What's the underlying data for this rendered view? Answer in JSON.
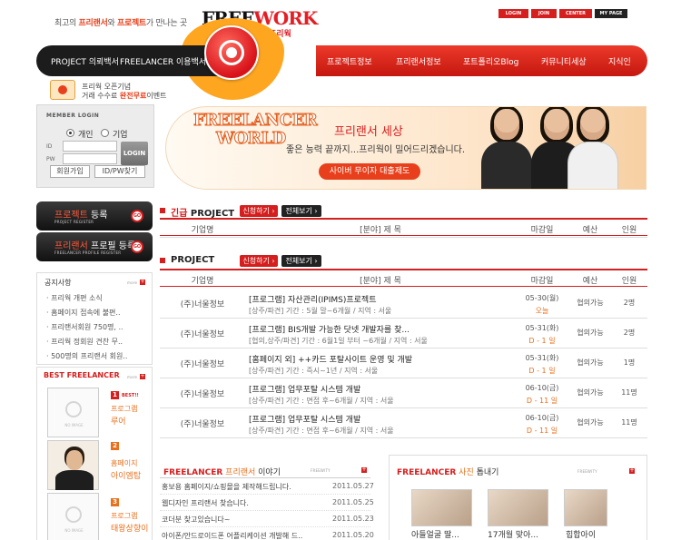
{
  "header": {
    "tagline_a": "최고의 ",
    "tagline_b": "프리랜서",
    "tagline_c": "와 ",
    "tagline_d": "프로젝트",
    "tagline_e": "가 만나는 곳",
    "logo_a": "FREE",
    "logo_b": "WORK",
    "logo_sub": "프리웍",
    "top_links": [
      "LOGIN",
      "JOIN",
      "CENTER",
      "MY PAGE"
    ]
  },
  "nav": {
    "left_items": [
      "PROJECT 의뢰백서",
      "FREELANCER 이용백서"
    ],
    "right_items": [
      "프로젝트정보",
      "프리랜서정보",
      "포트폴리오Blog",
      "커뮤니티세상",
      "지식인"
    ]
  },
  "event": {
    "line1": "프리웍 오픈기념",
    "line2_a": "거래 수수료 ",
    "line2_b": "완전무료",
    "line2_c": "이벤트"
  },
  "login": {
    "title": "MEMBER LOGIN",
    "type_personal": "개인",
    "type_company": "기업",
    "selected": "개인",
    "id_label": "ID",
    "pw_label": "PW",
    "id_value": "",
    "pw_value": "",
    "login_button": "LOGIN",
    "join_button": "회원가입",
    "find_button": "ID/PW찾기"
  },
  "banner": {
    "title1": "FREELANCER",
    "title2": "WORLD",
    "heading": "프리랜서 세상",
    "subtitle": "좋은 능력 끝까지...프리웍이 밀어드리겠습니다.",
    "button": "사이버 무이자 대출제도"
  },
  "side_buttons": [
    {
      "hl": "프로젝트",
      "label": " 등록",
      "sub": "PROJECT REGISTER",
      "go": "GO"
    },
    {
      "hl": "프리랜서",
      "label": " 프로필 등록",
      "sub": "FREELANCER PROFILE REGISTER",
      "go": "GO"
    }
  ],
  "notice": {
    "title": "공지사항",
    "more": "more",
    "plus": "+",
    "items": [
      "프리웍 개편 소식",
      "홈페이지 접속에 불편..",
      "프리랜서회원 750명, ..",
      "프리웍 정회원 견찬 무..",
      "500명의 프리랜서 회원.."
    ]
  },
  "best": {
    "title": "BEST FREELANCER",
    "more": "more",
    "plus": "+",
    "badge": "BEST!!",
    "noimg": "NO IMAGE",
    "items": [
      {
        "rank": "1",
        "category": "프로그램",
        "name": "루어"
      },
      {
        "rank": "2",
        "category": "홈페이지",
        "name": "아이엠탑"
      },
      {
        "rank": "3",
        "category": "프로그램",
        "name": "태왕상향이"
      }
    ]
  },
  "urgent": {
    "title_hl": "긴급",
    "title": " PROJECT",
    "apply": "신청하기 ›",
    "view_all": "전체보기 ›",
    "columns": [
      "기업명",
      "[분야] 제 목",
      "마감일",
      "예산",
      "인원"
    ]
  },
  "project": {
    "title": "PROJECT",
    "apply": "신청하기 ›",
    "view_all": "전체보기 ›",
    "columns": [
      "기업명",
      "[분야] 제 목",
      "마감일",
      "예산",
      "인원"
    ],
    "rows": [
      {
        "company": "(주)너울정보",
        "title": "[프로그램] 자산관리(IPIMS)프로젝트",
        "sub": "[상주/파견] 기간 : 5월 말~6개월 / 지역 : 서울",
        "date": "05-30(월)",
        "dday": "오늘",
        "budget": "협의가능",
        "people": "2명"
      },
      {
        "company": "(주)너울정보",
        "title": "[프로그램] BIS개발 가능한 닷넷 개발자를 찾...",
        "sub": "[협의,상주/파견] 기간 : 6월1일 부터 ~6개월 / 지역 : 서울",
        "date": "05-31(화)",
        "dday": "D - 1 일",
        "budget": "협의가능",
        "people": "2명"
      },
      {
        "company": "(주)너울정보",
        "title": "[홈페이지 외] ++카드 포탈사이트 운영 및 개발",
        "sub": "[상주/파견] 기간 : 즉시~1년 / 지역 : 서울",
        "date": "05-31(화)",
        "dday": "D - 1 일",
        "budget": "협의가능",
        "people": "1명"
      },
      {
        "company": "(주)너울정보",
        "title": "[프로그램] 업무포탈 시스템 개발",
        "sub": "[상주/파견] 기간 : 면접 후~6개월 / 지역 : 서울",
        "date": "06-10(금)",
        "dday": "D - 11 일",
        "budget": "협의가능",
        "people": "11명"
      },
      {
        "company": "(주)너울정보",
        "title": "[프로그램] 업무포탈 시스템 개발",
        "sub": "[상주/파견] 기간 : 면접 후~6개월 / 지역 : 서울",
        "date": "06-10(금)",
        "dday": "D - 11 일",
        "budget": "협의가능",
        "people": "11명"
      }
    ]
  },
  "story": {
    "title_a": "FREELANCER",
    "title_b": " 프리랜서",
    "title_c": " 이야기",
    "more": "FREEWITY",
    "plus": "+",
    "items": [
      {
        "text": "홍보용 홈페이지/쇼핑몰을 제작해드립니다.",
        "date": "2011.05.27"
      },
      {
        "text": "웹디자인 프리랜서 찾습니다.",
        "date": "2011.05.25"
      },
      {
        "text": "코더분 찾고있습니다~",
        "date": "2011.05.23"
      },
      {
        "text": "아이폰/안드로이드폰 어플리케이션 개발해 드..",
        "date": "2011.05.20"
      }
    ]
  },
  "photos": {
    "title_a": "FREELANCER",
    "title_b": " 사진",
    "title_c": " 톱내기",
    "more": "FREEWITY",
    "plus": "+",
    "items": [
      {
        "caption": "아들얼굴 딸..."
      },
      {
        "caption": "17개월 맞아..."
      },
      {
        "caption": "힙합아이"
      }
    ]
  },
  "colors": {
    "brand_red": "#d51e1e",
    "accent_orange": "#ffa621",
    "nav_dark": "#1c1c1c"
  }
}
